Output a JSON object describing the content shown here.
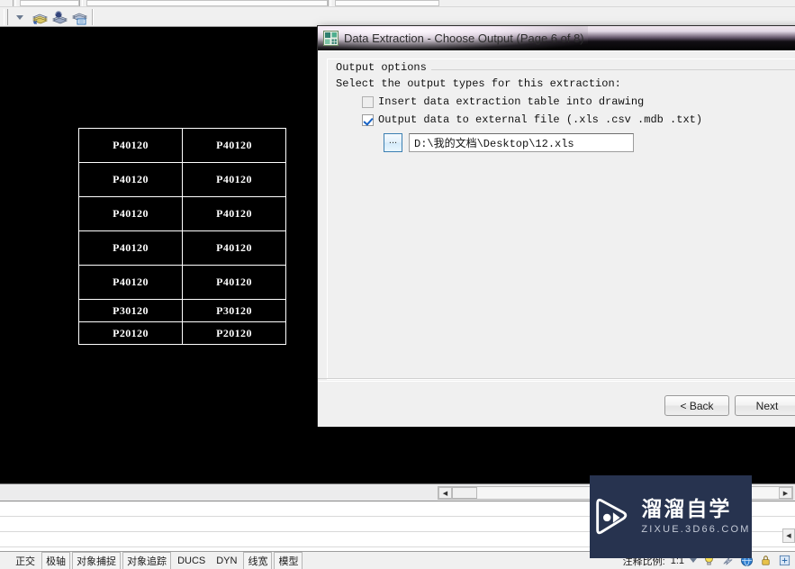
{
  "app": {
    "toolbar": {
      "buttons": [
        {
          "name": "layer-dropdown-arrow",
          "icon": "chevron-down-icon"
        },
        {
          "name": "layer-properties",
          "icon": "layers-icon"
        },
        {
          "name": "layer-previous",
          "icon": "layers-back-icon"
        },
        {
          "name": "layer-states",
          "icon": "layers-states-icon"
        }
      ]
    },
    "canvas": {
      "table": {
        "rows": [
          {
            "height": "tall",
            "cells": [
              "P40120",
              "P40120"
            ]
          },
          {
            "height": "tall",
            "cells": [
              "P40120",
              "P40120"
            ]
          },
          {
            "height": "tall",
            "cells": [
              "P40120",
              "P40120"
            ]
          },
          {
            "height": "tall",
            "cells": [
              "P40120",
              "P40120"
            ]
          },
          {
            "height": "tall",
            "cells": [
              "P40120",
              "P40120"
            ]
          },
          {
            "height": "short",
            "cells": [
              "P30120",
              "P30120"
            ]
          },
          {
            "height": "short",
            "cells": [
              "P20120",
              "P20120"
            ]
          }
        ]
      }
    },
    "statusbar": {
      "toggles": [
        "正交",
        "极轴",
        "对象捕捉",
        "对象追踪",
        "DUCS",
        "DYN",
        "线宽",
        "模型"
      ],
      "annotation_scale_label": "注释比例:",
      "annotation_scale_value": "1:1"
    }
  },
  "dialog": {
    "title": "Data Extraction - Choose Output (Page 6 of 8)",
    "icon": "data-extraction-icon",
    "group_title": "Output options",
    "instruction": "Select the output types for this extraction:",
    "options": [
      {
        "label": "Insert data extraction table into drawing",
        "checked": false
      },
      {
        "label": "Output data to external file (.xls .csv .mdb .txt)",
        "checked": true
      }
    ],
    "browse_button_label": "...",
    "file_path": "D:\\我的文档\\Desktop\\12.xls",
    "buttons": {
      "back": "< Back",
      "next": "Next"
    }
  },
  "watermark": {
    "cn": "溜溜自学",
    "en": "ZIXUE.3D66.COM",
    "icon": "play-logo-icon",
    "bg_color": "#27334f"
  }
}
